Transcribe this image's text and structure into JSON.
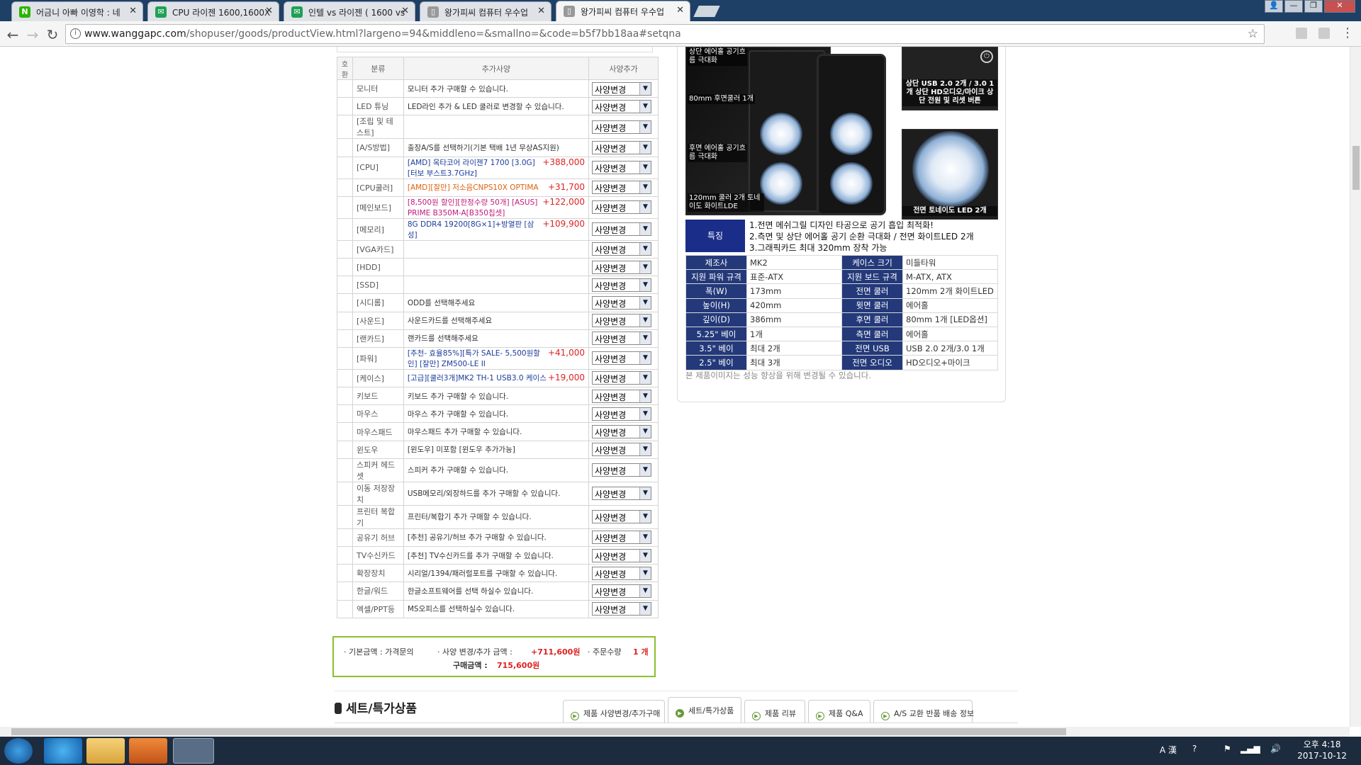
{
  "browser": {
    "tabs": [
      {
        "label": "어금니 아빠 이영학 : 네",
        "fav": "N",
        "fav_color": "#2db400"
      },
      {
        "label": "CPU 라이젠 1600,1600X",
        "fav": "✉",
        "fav_color": "#1fa055"
      },
      {
        "label": "인텔 vs 라이젠 ( 1600 vs",
        "fav": "✉",
        "fav_color": "#1fa055"
      },
      {
        "label": "왕가피씨 컴퓨터 우수업",
        "fav": "▯",
        "fav_color": "#888888"
      },
      {
        "label": "왕가피씨 컴퓨터 우수업",
        "fav": "▯",
        "fav_color": "#888888"
      }
    ],
    "url_host": "www.wanggapc.com",
    "url_path": "/shopuser/goods/productView.html?largeno=94&middleno=&smallno=&code=b5f7bb18aa#setqna"
  },
  "spec_table": {
    "headers": {
      "check": "호환",
      "category": "분류",
      "option": "추가사양",
      "change": "사양추가"
    },
    "select_label": "사양변경",
    "rows": [
      {
        "cat": "모니터",
        "text": "모니터 추가 구매할 수 있습니다.",
        "price": ""
      },
      {
        "cat": "LED 튜닝",
        "text": "LED라인 추가 & LED 쿨러로 변경할 수 있습니다.",
        "price": ""
      },
      {
        "cat": "[조립 및 테스트]",
        "text": "",
        "price": ""
      },
      {
        "cat": "[A/S방법]",
        "text": "출장A/S를 선택하기(기본 택배 1년 무상AS지원)",
        "price": ""
      },
      {
        "cat": "[CPU]",
        "text": "[AMD] 옥타코어 라이젠7 1700 [3.0G] [터보 부스트3.7GHz]",
        "price": "+388,000"
      },
      {
        "cat": "[CPU쿨러]",
        "text": "[AMD][잘만] 저소음CNPS10X OPTIMA",
        "price": "+31,700"
      },
      {
        "cat": "[메인보드]",
        "text": "[8,500원 할인][한정수량 50개] [ASUS] PRIME B350M-A[B350칩셋]",
        "price": "+122,000"
      },
      {
        "cat": "[메모리]",
        "text": "8G DDR4 19200[8G×1]+방열판 [삼성]",
        "price": "+109,900"
      },
      {
        "cat": "[VGA카드]",
        "text": "",
        "price": ""
      },
      {
        "cat": "[HDD]",
        "text": "",
        "price": ""
      },
      {
        "cat": "[SSD]",
        "text": "",
        "price": ""
      },
      {
        "cat": "[시디롬]",
        "text": "ODD를 선택해주세요",
        "price": ""
      },
      {
        "cat": "[사운드]",
        "text": "사운드카드를 선택해주세요",
        "price": ""
      },
      {
        "cat": "[랜카드]",
        "text": "랜카드를 선택해주세요",
        "price": ""
      },
      {
        "cat": "[파워]",
        "text": "[추천- 효율85%][특가 SALE- 5,500원할인] [잘만] ZM500-LE II",
        "price": "+41,000"
      },
      {
        "cat": "[케이스]",
        "text": "[고급][쿨러3개]MK2 TH-1 USB3.0 케이스",
        "price": "+19,000"
      },
      {
        "cat": "키보드",
        "text": "키보드 추가 구매할 수 있습니다.",
        "price": ""
      },
      {
        "cat": "마우스",
        "text": "마우스 추가 구매할 수 있습니다.",
        "price": ""
      },
      {
        "cat": "마우스패드",
        "text": "마우스패드 추가 구매할 수 있습니다.",
        "price": ""
      },
      {
        "cat": "윈도우",
        "text": "[윈도우] 미포함 [윈도우 추가가능]",
        "price": ""
      },
      {
        "cat": "스피커 헤드셋",
        "text": "스피커 추가 구매할 수 있습니다.",
        "price": ""
      },
      {
        "cat": "이동 저장장치",
        "text": "USB메모리/외장하드를 추가 구매할 수 있습니다.",
        "price": ""
      },
      {
        "cat": "프린터 복합기",
        "text": "프린터/복합기 추가 구매할 수 있습니다.",
        "price": ""
      },
      {
        "cat": "공유기 허브",
        "text": "[추천] 공유기/허브 추가 구매할 수 있습니다.",
        "price": ""
      },
      {
        "cat": "TV수신카드",
        "text": "[추천] TV수신카드를 추가 구매할 수 있습니다.",
        "price": ""
      },
      {
        "cat": "확장장치",
        "text": "시리얼/1394/패러럴포트를 구매할 수 있습니다.",
        "price": ""
      },
      {
        "cat": "한글/워드",
        "text": "한글소프트웨어를 선택 하실수 있습니다.",
        "price": ""
      },
      {
        "cat": "엑셀/PPT등",
        "text": "MS오피스를 선택하실수 있습니다.",
        "price": ""
      }
    ]
  },
  "totals": {
    "base_label": "· 기본금액 : 가격문의",
    "change_label": "· 사양 변경/추가 금액 :",
    "change_value": "+711,600원",
    "qty_label": "· 주문수량",
    "qty_value": "1 개",
    "total_label": "구매금액 :",
    "total_value": "715,600원"
  },
  "section": {
    "set_title": "세트/특가상품",
    "tabs": [
      "제품 사양변경/추가구매",
      "세트/특가상품",
      "제품 리뷰",
      "제품 Q&A",
      "A/S 교환 반품 배송 정보"
    ]
  },
  "product": {
    "captions": {
      "top_cut": "상단 에어홀 공기흐름 극대화",
      "rear_fan": "80mm 후면쿨러 1개",
      "rear_air": "후면 에어홀 공기흐름 극대화",
      "front_fan": "120mm 쿨러 2개 토네이도 화이트LDE",
      "usb": "상단 USB 2.0 2개 / 3.0 1개 상단 HD오디오/마이크 상단 전원 및 리셋 버튼",
      "led": "전면 토네이도 LED 2개"
    },
    "feature_label": "특징",
    "features": [
      "1.전면 메쉬그릴 디자인 타공으로 공기 흡입 최적화!",
      "2.측면 및 상단 에어홀 공기 순환 극대화 / 전면 화이트LED 2개",
      "3.그래픽카드 최대 320mm 장착 가능"
    ],
    "specs": [
      [
        "제조사",
        "MK2",
        "케이스 크기",
        "미들타워"
      ],
      [
        "지원 파워 규격",
        "표준-ATX",
        "지원 보드 규격",
        "M-ATX, ATX"
      ],
      [
        "폭(W)",
        "173mm",
        "전면 쿨러",
        "120mm 2개 화이트LED"
      ],
      [
        "높이(H)",
        "420mm",
        "윗면 쿨러",
        "에어홀"
      ],
      [
        "깊이(D)",
        "386mm",
        "후면 쿨러",
        "80mm 1개 [LED옵션]"
      ],
      [
        "5.25\" 베이",
        "1개",
        "측면 쿨러",
        "에어홀"
      ],
      [
        "3.5\" 베이",
        "최대 2개",
        "전면 USB",
        "USB 2.0 2개/3.0 1개"
      ],
      [
        "2.5\" 베이",
        "최대 3개",
        "전면 오디오",
        "HD오디오+마이크"
      ]
    ],
    "note": "본 제품이미지는 성능 향상을 위해 변경될 수 있습니다."
  },
  "taskbar": {
    "ime": "A 漢",
    "time": "오후 4:18",
    "date": "2017-10-12"
  }
}
